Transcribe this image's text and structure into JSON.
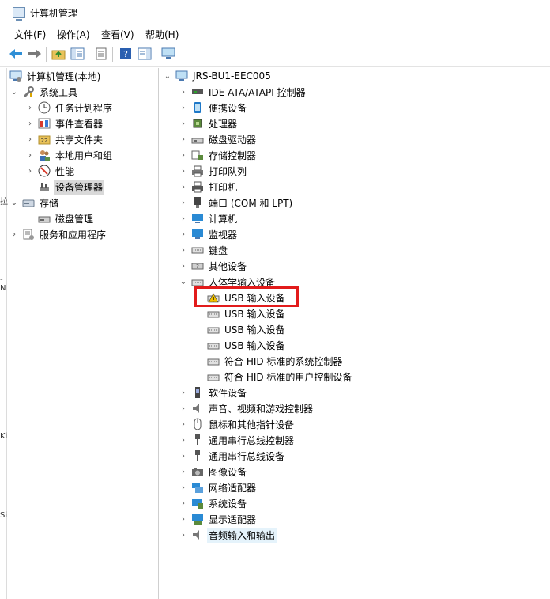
{
  "window": {
    "title": "计算机管理"
  },
  "menu": [
    "文件(F)",
    "操作(A)",
    "查看(V)",
    "帮助(H)"
  ],
  "toolbar": {
    "buttons": [
      "back-icon",
      "forward-icon",
      "up-folder-icon",
      "show-hide-tree-icon",
      "export-list-icon",
      "help-icon",
      "action-pane-icon",
      "monitor-icon"
    ]
  },
  "left_tree": [
    {
      "label": "计算机管理(本地)",
      "icon": "computer-management-icon",
      "level": 0,
      "expanded": true
    },
    {
      "label": "系统工具",
      "icon": "tools-icon",
      "level": 1,
      "expanded": true
    },
    {
      "label": "任务计划程序",
      "icon": "clock-icon",
      "level": 2,
      "expanded": false
    },
    {
      "label": "事件查看器",
      "icon": "event-viewer-icon",
      "level": 2,
      "expanded": false
    },
    {
      "label": "共享文件夹",
      "icon": "shared-folder-icon",
      "level": 2,
      "expanded": false
    },
    {
      "label": "本地用户和组",
      "icon": "users-icon",
      "level": 2,
      "expanded": false
    },
    {
      "label": "性能",
      "icon": "performance-icon",
      "level": 2,
      "expanded": false
    },
    {
      "label": "设备管理器",
      "icon": "device-manager-icon",
      "level": 2,
      "selected": true
    },
    {
      "label": "存储",
      "icon": "storage-icon",
      "level": 1,
      "expanded": true
    },
    {
      "label": "磁盘管理",
      "icon": "disk-management-icon",
      "level": 2
    },
    {
      "label": "服务和应用程序",
      "icon": "services-icon",
      "level": 1,
      "expanded": false
    }
  ],
  "device_tree": {
    "root": "JRS-BU1-EEC005",
    "categories": [
      {
        "label": "IDE ATA/ATAPI 控制器",
        "icon": "ide-controller-icon"
      },
      {
        "label": "便携设备",
        "icon": "portable-device-icon"
      },
      {
        "label": "处理器",
        "icon": "processor-icon"
      },
      {
        "label": "磁盘驱动器",
        "icon": "disk-drive-icon"
      },
      {
        "label": "存储控制器",
        "icon": "storage-controller-icon"
      },
      {
        "label": "打印队列",
        "icon": "print-queue-icon"
      },
      {
        "label": "打印机",
        "icon": "printer-icon"
      },
      {
        "label": "端口 (COM 和 LPT)",
        "icon": "port-icon"
      },
      {
        "label": "计算机",
        "icon": "computer-icon"
      },
      {
        "label": "监视器",
        "icon": "monitor-icon"
      },
      {
        "label": "键盘",
        "icon": "keyboard-icon"
      },
      {
        "label": "其他设备",
        "icon": "other-device-icon"
      },
      {
        "label": "人体学输入设备",
        "icon": "hid-icon",
        "expanded": true,
        "children": [
          {
            "label": "USB 输入设备",
            "icon": "warning-hid-icon",
            "warning": true,
            "highlighted": true
          },
          {
            "label": "USB 输入设备",
            "icon": "hid-icon"
          },
          {
            "label": "USB 输入设备",
            "icon": "hid-icon"
          },
          {
            "label": "USB 输入设备",
            "icon": "hid-icon"
          },
          {
            "label": "符合 HID 标准的系统控制器",
            "icon": "hid-icon"
          },
          {
            "label": "符合 HID 标准的用户控制设备",
            "icon": "hid-icon"
          }
        ]
      },
      {
        "label": "软件设备",
        "icon": "software-device-icon"
      },
      {
        "label": "声音、视频和游戏控制器",
        "icon": "sound-icon"
      },
      {
        "label": "鼠标和其他指针设备",
        "icon": "mouse-icon"
      },
      {
        "label": "通用串行总线控制器",
        "icon": "usb-icon"
      },
      {
        "label": "通用串行总线设备",
        "icon": "usb-icon"
      },
      {
        "label": "图像设备",
        "icon": "camera-icon"
      },
      {
        "label": "网络适配器",
        "icon": "network-icon"
      },
      {
        "label": "系统设备",
        "icon": "system-device-icon"
      },
      {
        "label": "显示适配器",
        "icon": "display-adapter-icon"
      },
      {
        "label": "音频输入和输出",
        "icon": "audio-io-icon",
        "selected": true
      }
    ]
  },
  "colors": {
    "highlight_box": "#e21b1b",
    "selection": "#e5f3fb",
    "warning": "#f5c400"
  },
  "edge_fragments": [
    "拉",
    "-N",
    "Ki",
    "Si"
  ]
}
